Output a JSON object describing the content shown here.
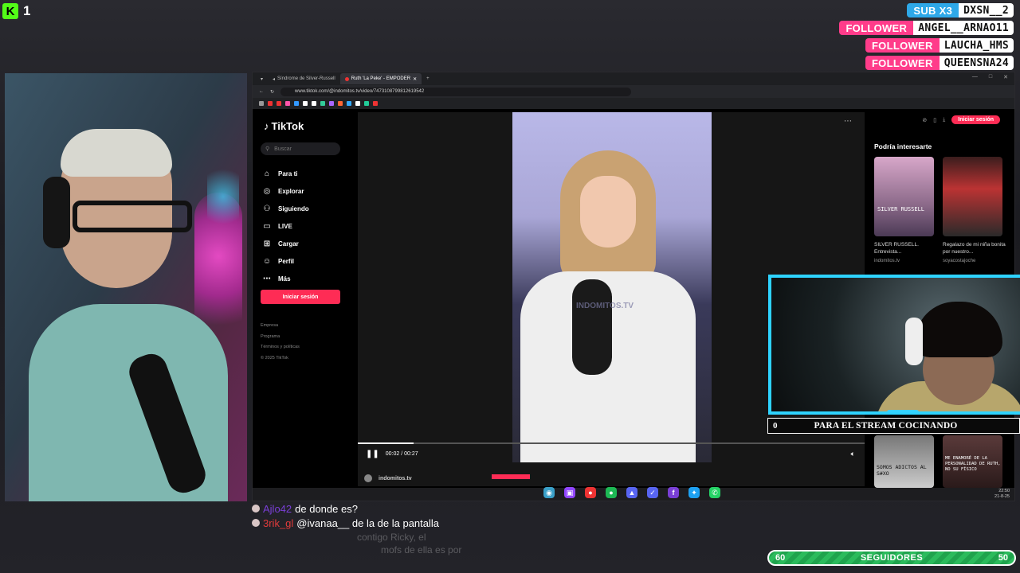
{
  "stream": {
    "kick_logo": "K",
    "viewer_count": "1"
  },
  "alerts": [
    {
      "tag": "SUB X3",
      "name": "DXSN__2",
      "color": "#2ea8e8"
    },
    {
      "tag": "FOLLOWER",
      "name": "ANGEL__ARNAO11",
      "color": "#ff3c8a"
    },
    {
      "tag": "FOLLOWER",
      "name": "LAUCHA_HMS",
      "color": "#ff3c8a"
    },
    {
      "tag": "FOLLOWER",
      "name": "QUEENSNA24",
      "color": "#ff3c8a"
    }
  ],
  "browser": {
    "tabs": [
      {
        "label": "Síndrome de Silver-Russell"
      },
      {
        "label": "Ruth 'La Peke' - EMPODER"
      }
    ],
    "url": "www.tiktok.com/@indomitos.tv/video/7473108799812619542",
    "window_controls": [
      "—",
      "□",
      "✕"
    ]
  },
  "tiktok": {
    "logo": "TikTok",
    "search_placeholder": "Buscar",
    "nav": [
      {
        "label": "Para ti",
        "icon": "home-icon"
      },
      {
        "label": "Explorar",
        "icon": "compass-icon"
      },
      {
        "label": "Siguiendo",
        "icon": "users-icon"
      },
      {
        "label": "LIVE",
        "icon": "live-icon"
      },
      {
        "label": "Cargar",
        "icon": "upload-icon"
      },
      {
        "label": "Perfil",
        "icon": "profile-icon"
      },
      {
        "label": "Más",
        "icon": "more-icon"
      }
    ],
    "login_button": "Iniciar sesión",
    "footer": [
      "Empresa",
      "Programa",
      "Términos y políticas",
      "© 2025 TikTok"
    ],
    "video": {
      "watermark": "INDOMITOS.TV",
      "time": "00:02 / 00:27",
      "progress": 0.11,
      "author": "indomitos.tv"
    },
    "top_right_login": "Iniciar sesión",
    "suggestions_title": "Podría interesarte",
    "suggestions": [
      {
        "caption": "SILVER RUSSELL. Entrevista...",
        "author": "indomitos.tv",
        "overlay": "SILVER RUSSELL"
      },
      {
        "caption": "Regalazo de mi niña bonita por nuestro...",
        "author": "soyacostajoche",
        "overlay": ""
      },
      {
        "caption": "",
        "author": "",
        "overlay": "SOMOS ADICTOS AL S#XO"
      },
      {
        "caption": "",
        "author": "",
        "overlay": "ME ENAMORÉ DE LA PERSONALIDAD DE RUTH, NO SU FÍSICO"
      }
    ],
    "clock": {
      "time": "22:50",
      "date": "21-8-25"
    }
  },
  "social_icons": [
    {
      "name": "discord-icon",
      "glyph": "◉",
      "color": "#3aa0c8"
    },
    {
      "name": "twitch-icon",
      "glyph": "▣",
      "color": "#9146ff"
    },
    {
      "name": "kick-icon",
      "glyph": "●",
      "color": "#e33"
    },
    {
      "name": "spotify-icon",
      "glyph": "●",
      "color": "#1db954"
    },
    {
      "name": "discord2-icon",
      "glyph": "▲",
      "color": "#5865f2"
    },
    {
      "name": "check-icon",
      "glyph": "✓",
      "color": "#5865f2"
    },
    {
      "name": "facebook-icon",
      "glyph": "f",
      "color": "#7a3fd6"
    },
    {
      "name": "twitter-icon",
      "glyph": "✦",
      "color": "#1da1f2"
    },
    {
      "name": "whatsapp-icon",
      "glyph": "✆",
      "color": "#25d366"
    }
  ],
  "guest": {
    "count": "0",
    "label": "PARA EL STREAM COCINANDO"
  },
  "chat": [
    {
      "user": "Ajlo42",
      "message": "de donde es?",
      "user_color": "#7a3fd6"
    },
    {
      "user": "3rik_gl",
      "message": "@ivanaa__ de la de la pantalla",
      "user_color": "#e13b3b"
    }
  ],
  "chat_faded": [
    "contigo Ricky, el",
    "mofs de ella es por"
  ],
  "goal": {
    "current": "60",
    "label": "SEGUIDORES",
    "target": "50",
    "color": "#2bbb5c"
  }
}
